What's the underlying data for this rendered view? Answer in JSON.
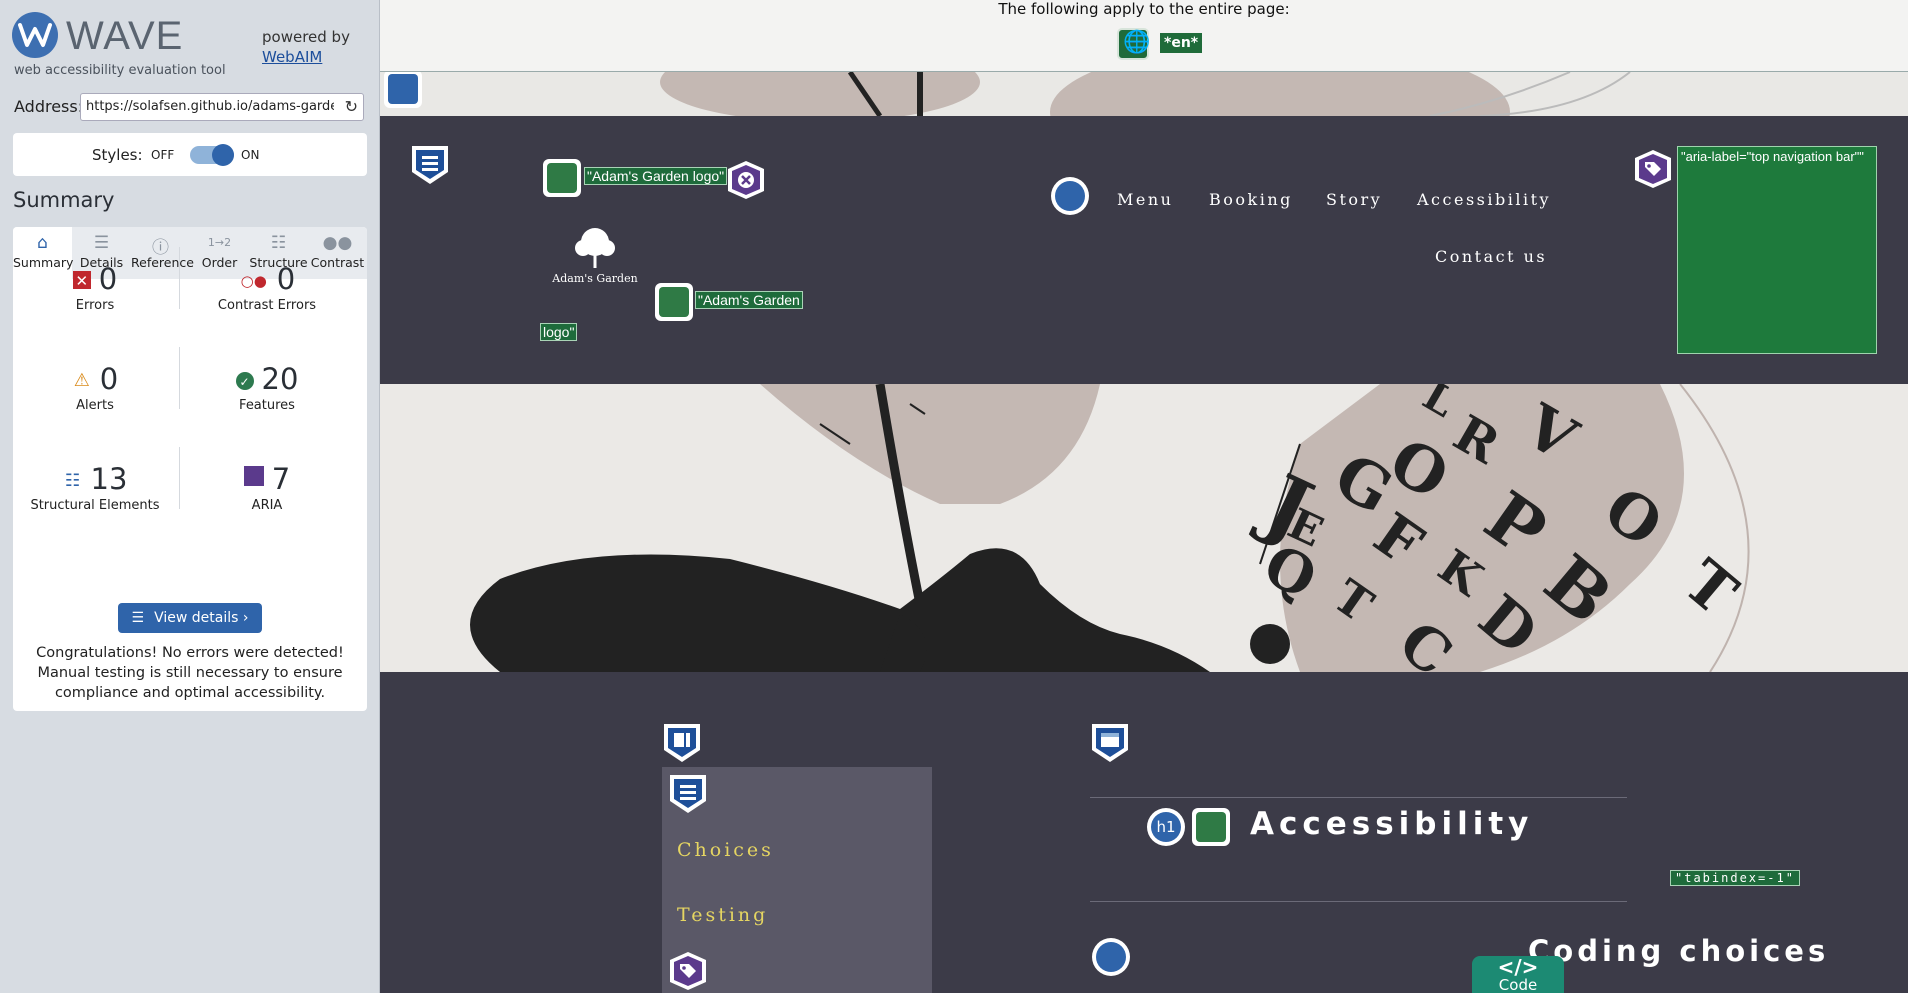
{
  "sidebar": {
    "brand": "WAVE",
    "tagline": "web accessibility evaluation tool",
    "powered_by": "powered by",
    "webaim_link": "WebAIM",
    "address_label": "Address:",
    "address_value": "https://solafsen.github.io/adams-garden-",
    "styles_label": "Styles:",
    "styles_off": "OFF",
    "styles_on": "ON",
    "summary_heading": "Summary",
    "tabs": [
      {
        "label": "Summary",
        "icon": "home-icon"
      },
      {
        "label": "Details",
        "icon": "list-icon"
      },
      {
        "label": "Reference",
        "icon": "info-icon"
      },
      {
        "label": "Order",
        "icon": "order-icon"
      },
      {
        "label": "Structure",
        "icon": "structure-icon"
      },
      {
        "label": "Contrast",
        "icon": "contrast-icon"
      }
    ],
    "stats": {
      "errors": {
        "value": "0",
        "label": "Errors"
      },
      "contrast_errors": {
        "value": "0",
        "label": "Contrast Errors"
      },
      "alerts": {
        "value": "0",
        "label": "Alerts"
      },
      "features": {
        "value": "20",
        "label": "Features"
      },
      "structural": {
        "value": "13",
        "label": "Structural Elements"
      },
      "aria": {
        "value": "7",
        "label": "ARIA"
      }
    },
    "view_details": "View details ›",
    "congrats": "Congratulations! No errors were detected! Manual testing is still necessary to ensure compliance and optimal accessibility."
  },
  "page": {
    "apply_text": "The following apply to the entire page:",
    "lang_tag": "*en*",
    "logo_alt_1": "\"Adam's Garden logo\"",
    "logo_caption": "Adam's Garden",
    "logo_alt_2a": "\"Adam's Garden",
    "logo_alt_2b": "logo\"",
    "nav": [
      "Menu",
      "Booking",
      "Story",
      "Accessibility",
      "Contact us"
    ],
    "aria_label": "\"aria-label=\"top navigation bar\"\"",
    "side_items": [
      "Choices",
      "Testing"
    ],
    "h1_badge": "h1",
    "h1_title": "Accessibility",
    "tabindex": "\"tabindex=-1\"",
    "h2_title": "Coding choices",
    "code_tab_icon": "</>",
    "code_tab_label": "Code",
    "hero_letters": "JGOFKDQETCRLVPBOT"
  },
  "colors": {
    "wave_blue": "#2f64aa",
    "header_bg": "#3c3b48",
    "alt_green": "#1e6b3b",
    "aria_purple": "#5b3a8c",
    "nav_yellow": "#e5d562"
  }
}
